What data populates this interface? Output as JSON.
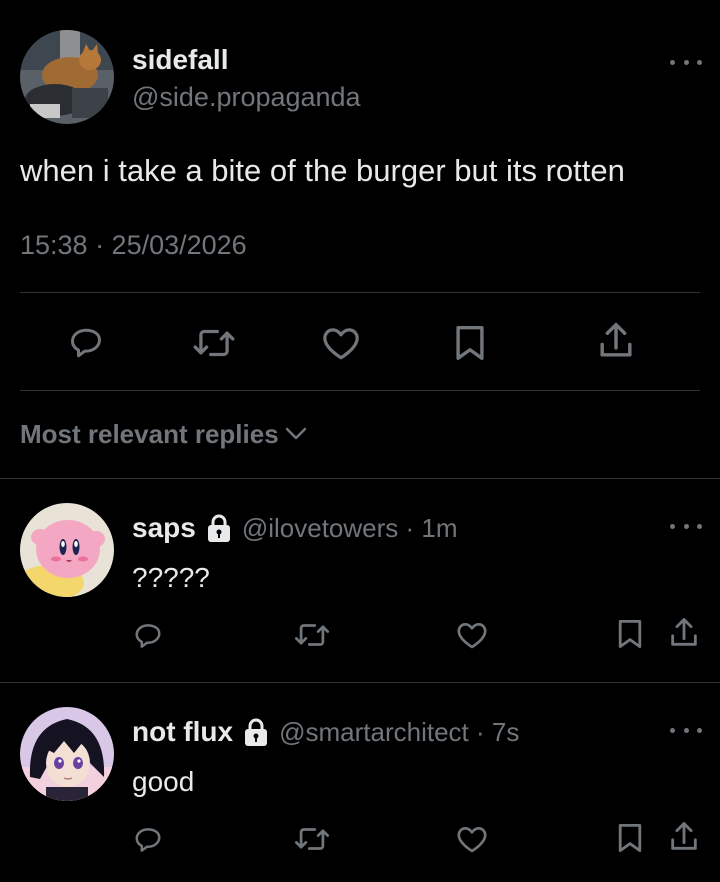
{
  "tweet": {
    "display_name": "sidefall",
    "handle": "@side.propaganda",
    "text": "when i take a bite of the burger but its rotten",
    "timestamp": "15:38 · 25/03/2026",
    "actions": [
      "reply-icon",
      "retweet-icon",
      "like-icon",
      "bookmark-icon",
      "share-icon"
    ]
  },
  "replies_header": {
    "label": "Most relevant replies"
  },
  "replies": [
    {
      "display_name": "saps",
      "handle_time": "@ilovetowers · 1m",
      "text": "?????"
    },
    {
      "display_name": "not flux",
      "handle_time": "@smartarchitect · 7s",
      "text": "good"
    }
  ],
  "colors": {
    "background": "#000000",
    "text_primary": "#e7e9ea",
    "text_secondary": "#71767b",
    "divider": "#2f3336"
  }
}
